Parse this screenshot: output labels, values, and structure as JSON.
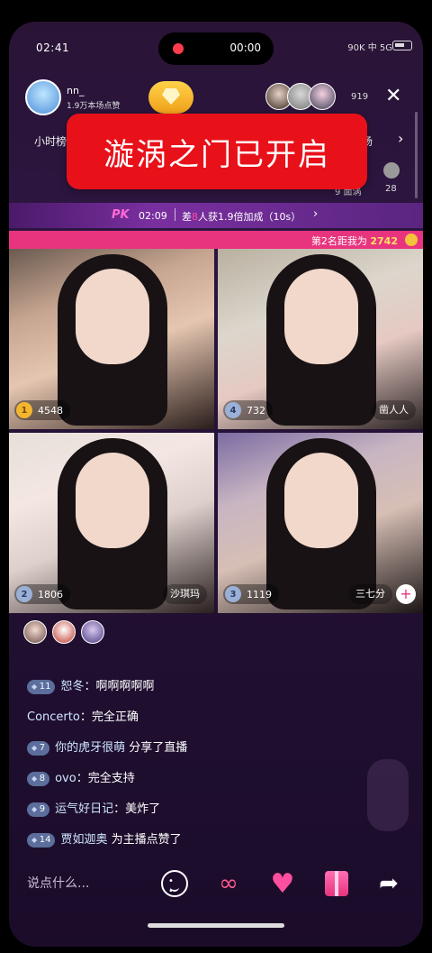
{
  "status": {
    "time": "02:41",
    "recording_time": "00:00",
    "signal_text": "90K 中 5G"
  },
  "host": {
    "name": "nn_",
    "subtitle": "1.9万本场点赞"
  },
  "viewers": {
    "count": "919"
  },
  "marquee": {
    "left_text": "小时榜",
    "right_text": "场"
  },
  "rank": {
    "label": "元 张",
    "sub_label": "9 面涡",
    "number": "28"
  },
  "toast": {
    "text": "漩涡之门已开启"
  },
  "pk": {
    "logo": "PK",
    "timer": "02:09",
    "msg_prefix": "差",
    "msg_highlight": "8",
    "msg_suffix": "人获1.9倍加成（10s）"
  },
  "rank_bar": {
    "prefix": "第2名距我为",
    "value": "2742"
  },
  "cells": [
    {
      "rank": "1",
      "score": "4548",
      "name": ""
    },
    {
      "rank": "4",
      "score": "732",
      "name": "凿人人"
    },
    {
      "rank": "2",
      "score": "1806",
      "name": "沙琪玛"
    },
    {
      "rank": "3",
      "score": "1119",
      "name": "三七分"
    }
  ],
  "chat": [
    {
      "level": "11",
      "user": "恕冬",
      "text": "啊啊啊啊啊"
    },
    {
      "level": "",
      "user": "Concerto",
      "text": "完全正确"
    },
    {
      "level": "7",
      "user": "你的虎牙很萌",
      "text": "分享了直播"
    },
    {
      "level": "8",
      "user": "ovo",
      "text": "完全支持"
    },
    {
      "level": "9",
      "user": "运气好日记",
      "text": "美炸了"
    },
    {
      "level": "14",
      "user": "贾如迦奥",
      "text": "为主播点赞了"
    }
  ],
  "input": {
    "placeholder": "说点什么..."
  },
  "icons": {
    "close": "close-icon",
    "smile": "smile-icon",
    "link": "link-icon",
    "heart": "heart-icon",
    "gift": "gift-icon",
    "share": "share-icon"
  },
  "colors": {
    "toast_bg": "#e8111a",
    "rank_bar": "#e8347e",
    "accent_pink": "#ff4fa0"
  }
}
